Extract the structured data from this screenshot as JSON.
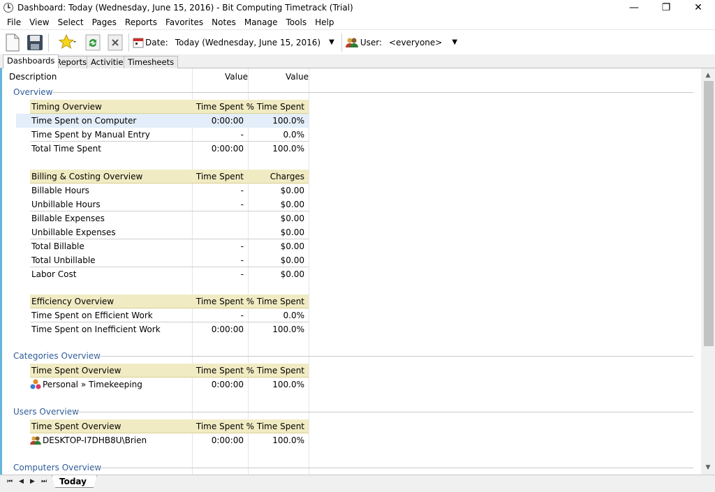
{
  "window": {
    "title": "Dashboard: Today (Wednesday, June 15, 2016) - Bit Computing Timetrack (Trial)",
    "minimize": "—",
    "maximize": "❐",
    "close": "✕"
  },
  "menu": [
    "File",
    "View",
    "Select",
    "Pages",
    "Reports",
    "Favorites",
    "Notes",
    "Manage",
    "Tools",
    "Help"
  ],
  "toolbar": {
    "date_label": "Date:",
    "date_value": "Today (Wednesday, June 15, 2016)",
    "user_label": "User:",
    "user_value": "<everyone>"
  },
  "tabs": [
    "Dashboards",
    "Reports",
    "Activities",
    "Timesheets"
  ],
  "columns": {
    "description": "Description",
    "value1": "Value",
    "value2": "Value"
  },
  "sections": {
    "overview": "Overview",
    "categories": "Categories Overview",
    "users": "Users Overview",
    "computers": "Computers Overview"
  },
  "timing": {
    "header": [
      "Timing Overview",
      "Time Spent",
      "% Time Spent"
    ],
    "rows": [
      [
        "Time Spent on Computer",
        "0:00:00",
        "100.0%"
      ],
      [
        "Time Spent by Manual Entry",
        "-",
        "0.0%"
      ],
      [
        "Total Time Spent",
        "0:00:00",
        "100.0%"
      ]
    ]
  },
  "billing": {
    "header": [
      "Billing & Costing Overview",
      "Time Spent",
      "Charges"
    ],
    "rows": [
      [
        "Billable Hours",
        "-",
        "$0.00"
      ],
      [
        "Unbillable Hours",
        "-",
        "$0.00"
      ],
      [
        "Billable Expenses",
        "",
        "$0.00"
      ],
      [
        "Unbillable Expenses",
        "",
        "$0.00"
      ],
      [
        "Total Billable",
        "-",
        "$0.00"
      ],
      [
        "Total Unbillable",
        "-",
        "$0.00"
      ],
      [
        "Labor Cost",
        "-",
        "$0.00"
      ]
    ]
  },
  "efficiency": {
    "header": [
      "Efficiency Overview",
      "Time Spent",
      "% Time Spent"
    ],
    "rows": [
      [
        "Time Spent on Efficient Work",
        "-",
        "0.0%"
      ],
      [
        "Time Spent on Inefficient Work",
        "0:00:00",
        "100.0%"
      ]
    ]
  },
  "categories": {
    "header": [
      "Time Spent Overview",
      "Time Spent",
      "% Time Spent"
    ],
    "rows": [
      [
        "Personal » Timekeeping",
        "0:00:00",
        "100.0%"
      ]
    ]
  },
  "users": {
    "header": [
      "Time Spent Overview",
      "Time Spent",
      "% Time Spent"
    ],
    "rows": [
      [
        "DESKTOP-I7DHB8U\\Brien",
        "0:00:00",
        "100.0%"
      ]
    ]
  },
  "sheet_tab": "Today"
}
